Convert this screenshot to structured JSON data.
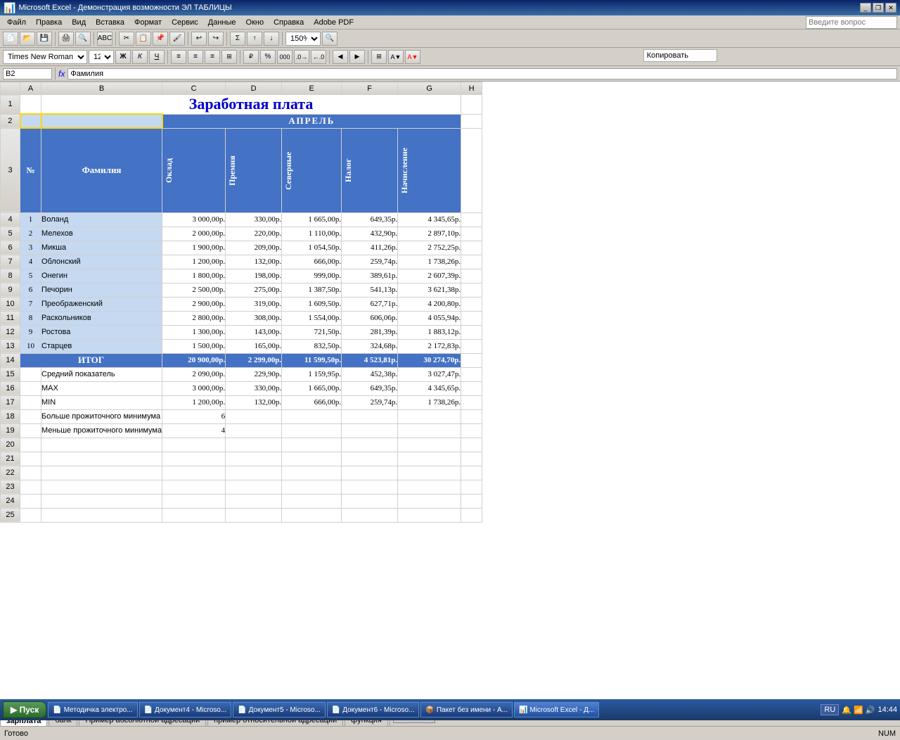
{
  "window": {
    "title": "Microsoft Excel - Демонстрация возможности ЭЛ ТАБЛИЦЫ",
    "titlebar_icon": "📊"
  },
  "menubar": {
    "items": [
      "Файл",
      "Правка",
      "Вид",
      "Вставка",
      "Формат",
      "Сервис",
      "Данные",
      "Окно",
      "Справка",
      "Adobe PDF"
    ]
  },
  "toolbar2": {
    "font": "Times New Roman",
    "size": "12"
  },
  "formula_bar": {
    "name_box": "B2",
    "formula": "Фамилия"
  },
  "spreadsheet": {
    "title": "Заработная плата",
    "month": "АПРЕЛЬ",
    "headers": {
      "no": "№",
      "name": "Фамилия",
      "salary": "Оклад",
      "bonus": "Премия",
      "north": "Северные",
      "tax": "Налог",
      "accrual": "Начисление"
    },
    "rows": [
      {
        "no": 1,
        "name": "Воланд",
        "salary": "3 000,00р.",
        "bonus": "330,00р.",
        "north": "1 665,00р.",
        "tax": "649,35р.",
        "accrual": "4 345,65р."
      },
      {
        "no": 2,
        "name": "Мелехов",
        "salary": "2 000,00р.",
        "bonus": "220,00р.",
        "north": "1 110,00р.",
        "tax": "432,90р.",
        "accrual": "2 897,10р."
      },
      {
        "no": 3,
        "name": "Микша",
        "salary": "1 900,00р.",
        "bonus": "209,00р.",
        "north": "1 054,50р.",
        "tax": "411,26р.",
        "accrual": "2 752,25р."
      },
      {
        "no": 4,
        "name": "Облонский",
        "salary": "1 200,00р.",
        "bonus": "132,00р.",
        "north": "666,00р.",
        "tax": "259,74р.",
        "accrual": "1 738,26р."
      },
      {
        "no": 5,
        "name": "Онегин",
        "salary": "1 800,00р.",
        "bonus": "198,00р.",
        "north": "999,00р.",
        "tax": "389,61р.",
        "accrual": "2 607,39р."
      },
      {
        "no": 6,
        "name": "Печорин",
        "salary": "2 500,00р.",
        "bonus": "275,00р.",
        "north": "1 387,50р.",
        "tax": "541,13р.",
        "accrual": "3 621,38р."
      },
      {
        "no": 7,
        "name": "Преображенский",
        "salary": "2 900,00р.",
        "bonus": "319,00р.",
        "north": "1 609,50р.",
        "tax": "627,71р.",
        "accrual": "4 200,80р."
      },
      {
        "no": 8,
        "name": "Раскольников",
        "salary": "2 800,00р.",
        "bonus": "308,00р.",
        "north": "1 554,00р.",
        "tax": "606,06р.",
        "accrual": "4 055,94р."
      },
      {
        "no": 9,
        "name": "Ростова",
        "salary": "1 300,00р.",
        "bonus": "143,00р.",
        "north": "721,50р.",
        "tax": "281,39р.",
        "accrual": "1 883,12р."
      },
      {
        "no": 10,
        "name": "Старцев",
        "salary": "1 500,00р.",
        "bonus": "165,00р.",
        "north": "832,50р.",
        "tax": "324,68р.",
        "accrual": "2 172,83р."
      }
    ],
    "itog": {
      "label": "ИТОГ",
      "salary": "20 900,00р.",
      "bonus": "2 299,00р.",
      "north": "11 599,50р.",
      "tax": "4 523,81р.",
      "accrual": "30 274,70р."
    },
    "stats": [
      {
        "label": "Средний показатель",
        "salary": "2 090,00р.",
        "bonus": "229,90р.",
        "north": "1 159,95р.",
        "tax": "452,38р.",
        "accrual": "3 027,47р."
      },
      {
        "label": "MAX",
        "salary": "3 000,00р.",
        "bonus": "330,00р.",
        "north": "1 665,00р.",
        "tax": "649,35р.",
        "accrual": "4 345,65р."
      },
      {
        "label": "MIN",
        "salary": "1 200,00р.",
        "bonus": "132,00р.",
        "north": "666,00р.",
        "tax": "259,74р.",
        "accrual": "1 738,26р."
      }
    ],
    "counts": [
      {
        "label": "Больше прожиточного минимума",
        "value": "6"
      },
      {
        "label": "Меньше прожиточного минимума",
        "value": "4"
      }
    ]
  },
  "tabs": [
    "зарплата",
    "банк",
    "Пример абсолютной адресации",
    "пример относительной адресации",
    "функция"
  ],
  "active_tab": "зарплата",
  "statusbar": {
    "left": "Готово",
    "right": "NUM"
  },
  "taskbar_items": [
    "Пуск",
    "Методичка электро...",
    "Документ4 - Microso...",
    "Документ5 - Microso...",
    "Документ6 - Microso...",
    "Пакет без имени - А...",
    "Microsoft Excel - Д..."
  ],
  "clock": "14:44"
}
